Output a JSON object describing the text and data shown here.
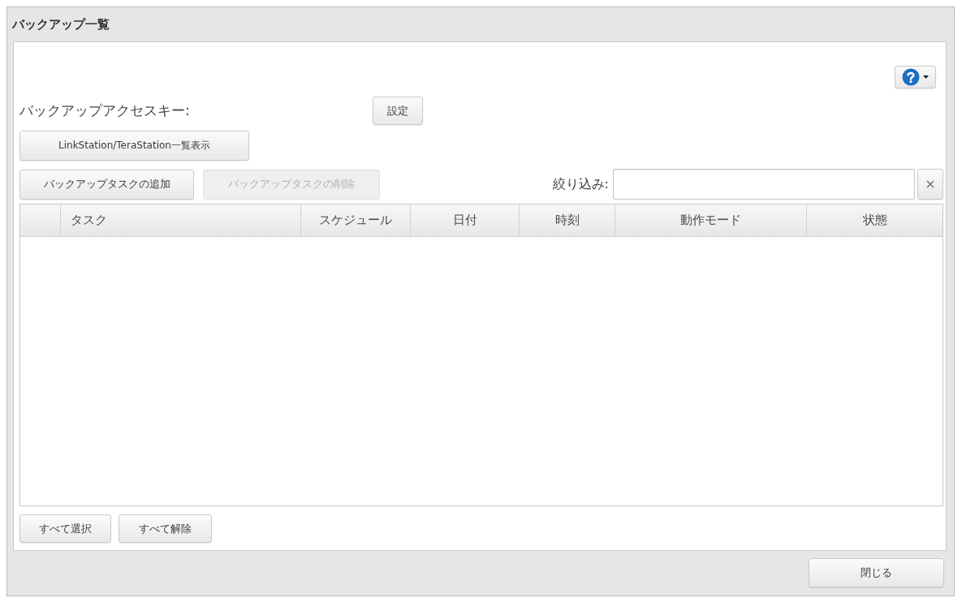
{
  "window": {
    "title": "バックアップ一覧"
  },
  "access_key": {
    "label": "バックアップアクセスキー:",
    "button": "設定"
  },
  "list_button": "LinkStation/TeraStation一覧表示",
  "task_buttons": [
    {
      "label": "バックアップタスクの追加",
      "disabled": false
    },
    {
      "label": "バックアップタスクの削除",
      "disabled": true
    }
  ],
  "filter": {
    "label": "絞り込み:"
  },
  "table": {
    "columns": [
      "タスク",
      "スケジュール",
      "日付",
      "時刻",
      "動作モード",
      "状態"
    ]
  },
  "selection_buttons": [
    "すべて選択",
    "すべて解除"
  ],
  "footer": {
    "close_button": "閉じる"
  }
}
